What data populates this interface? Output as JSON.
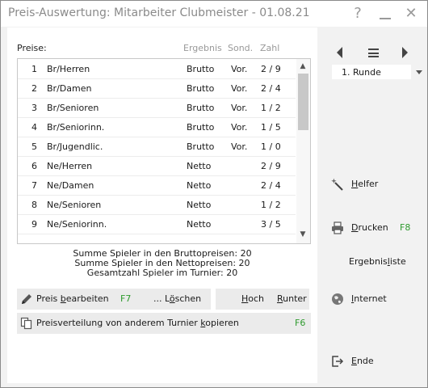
{
  "window": {
    "title": "Preis-Auswertung: Mitarbeiter Clubmeister - 01.08.21",
    "help_glyph": "?",
    "close_glyph": "✕"
  },
  "list": {
    "label": "Preise:",
    "columns": {
      "ergebnis": "Ergebnis",
      "sond": "Sond.",
      "zahl": "Zahl"
    },
    "rows": [
      {
        "num": "1",
        "name": "Br/Herren",
        "ergebnis": "Brutto",
        "sond": "Vor.",
        "zahl": "2 / 9"
      },
      {
        "num": "2",
        "name": "Br/Damen",
        "ergebnis": "Brutto",
        "sond": "Vor.",
        "zahl": "2 / 4"
      },
      {
        "num": "3",
        "name": "Br/Senioren",
        "ergebnis": "Brutto",
        "sond": "Vor.",
        "zahl": "1 / 2"
      },
      {
        "num": "4",
        "name": "Br/Seniorinn.",
        "ergebnis": "Brutto",
        "sond": "Vor.",
        "zahl": "1 / 5"
      },
      {
        "num": "5",
        "name": "Br/Jugendlic.",
        "ergebnis": "Brutto",
        "sond": "Vor.",
        "zahl": "1 / 0"
      },
      {
        "num": "6",
        "name": "Ne/Herren",
        "ergebnis": "Netto",
        "sond": "",
        "zahl": "2 / 9"
      },
      {
        "num": "7",
        "name": "Ne/Damen",
        "ergebnis": "Netto",
        "sond": "",
        "zahl": "2 / 4"
      },
      {
        "num": "8",
        "name": "Ne/Senioren",
        "ergebnis": "Netto",
        "sond": "",
        "zahl": "1 / 2"
      },
      {
        "num": "9",
        "name": "Ne/Seniorinn.",
        "ergebnis": "Netto",
        "sond": "",
        "zahl": "3 / 5"
      }
    ]
  },
  "summary": {
    "brutto": "Summe Spieler in den Bruttopreisen: 20",
    "netto": "Summe Spieler in den Nettopreisen: 20",
    "gesamt": "Gesamtzahl Spieler im Turnier: 20"
  },
  "actions": {
    "edit_pre": "Preis ",
    "edit_u": "b",
    "edit_post": "earbeiten",
    "edit_key": "F7",
    "delete_pre": "... L",
    "delete_u": "ö",
    "delete_post": "schen",
    "up_u": "H",
    "up_post": "och",
    "down_u": "R",
    "down_post": "unter",
    "copy_pre": "Preisverteilung von anderem Turnier ",
    "copy_u": "k",
    "copy_post": "opieren",
    "copy_key": "F6"
  },
  "sidebar": {
    "round": "1. Runde",
    "helper_u": "H",
    "helper_post": "elfer",
    "print_u": "D",
    "print_post": "rucken",
    "print_key": "F8",
    "results_pre": "Ergebnis",
    "results_u": "l",
    "results_post": "iste",
    "internet_u": "I",
    "internet_post": "nternet",
    "end_u": "E",
    "end_post": "nde"
  },
  "colors": {
    "function_key": "#2e9a2e",
    "title_text": "#8a8a8a"
  }
}
